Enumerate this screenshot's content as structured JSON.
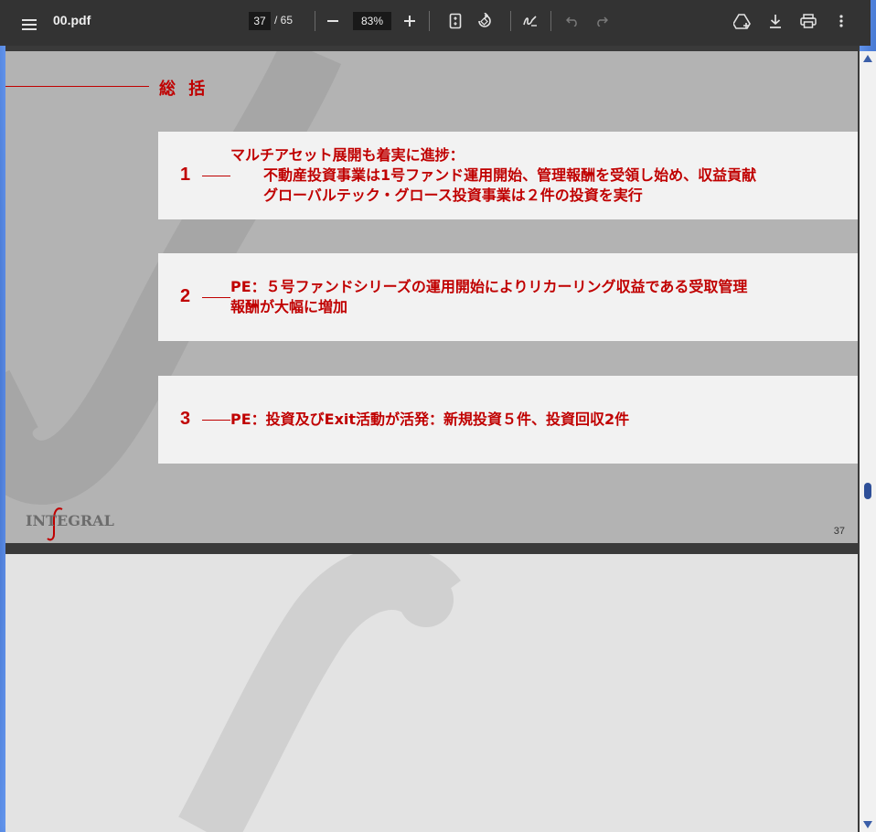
{
  "toolbar": {
    "filename": "00.pdf",
    "current_page": "37",
    "total_pages": "/ 65",
    "zoom": "83%",
    "icons": [
      "menu-icon",
      "zoom-out-icon",
      "zoom-in-icon",
      "fit-page-icon",
      "rotate-icon",
      "annotate-icon",
      "undo-icon",
      "redo-icon",
      "save-to-drive-icon",
      "download-icon",
      "print-icon",
      "more-icon"
    ]
  },
  "slide": {
    "section_title": "総 括",
    "items": [
      {
        "number": "1",
        "lines": [
          "マルチアセット展開も着実に進捗：",
          "不動産投資事業は1号ファンド運用開始、管理報酬を受領し始め、収益貢献",
          "グローバルテック・グロース投資事業は２件の投資を実行"
        ]
      },
      {
        "number": "2",
        "lines": [
          "PE：５号ファンドシリーズの運用開始によりリカーリング収益である受取管理",
          "報酬が大幅に増加"
        ]
      },
      {
        "number": "3",
        "lines": [
          "PE：投資及びExit活動が活発：新規投資５件、投資回収2件"
        ]
      }
    ],
    "logo_text": "INTEGRAL",
    "page_number": "37"
  },
  "colors": {
    "accent": "#c00000",
    "toolbar_bg": "#333333",
    "page_bg": "#b3b3b3",
    "card_bg": "#f2f2f2"
  }
}
